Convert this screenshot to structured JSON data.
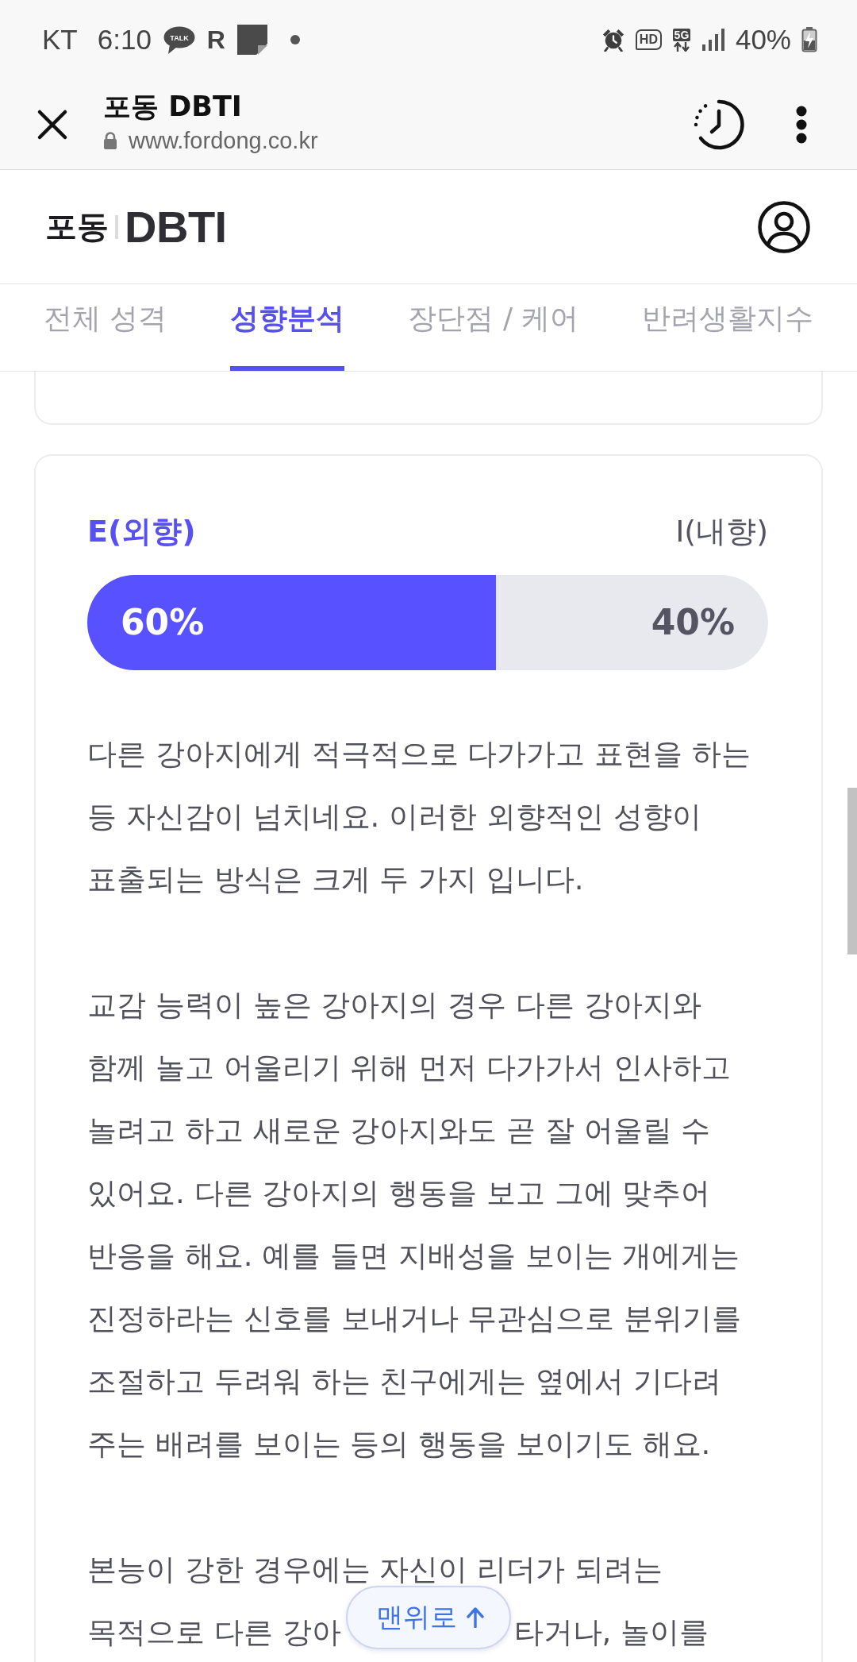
{
  "status_bar": {
    "carrier": "KT",
    "time": "6:10",
    "notifications": [
      {
        "kind": "bubble",
        "label": "TALK"
      },
      {
        "kind": "letter",
        "label": "R"
      },
      {
        "kind": "note"
      },
      {
        "kind": "dot"
      }
    ],
    "indicators": [
      {
        "kind": "alarm"
      },
      {
        "kind": "badge",
        "label": "HD"
      },
      {
        "kind": "network",
        "label": "5G"
      },
      {
        "kind": "signal"
      }
    ],
    "battery": "40%"
  },
  "browser_bar": {
    "title": "포동 DBTI",
    "url": "www.fordong.co.kr"
  },
  "site_header": {
    "logo": {
      "brand": "포동",
      "product": "DBTI"
    }
  },
  "tabs": [
    {
      "label": "전체 성격",
      "selected": false
    },
    {
      "label": "성향분석",
      "selected": true
    },
    {
      "label": "장단점 / 케어",
      "selected": false
    },
    {
      "label": "반려생활지수",
      "selected": false
    }
  ],
  "trait_card": {
    "left_label": "E(외향)",
    "right_label": "I(내향)",
    "level": 0.6,
    "left_reading": "60%",
    "right_reading": "40%",
    "paragraphs": [
      {
        "text": "다른 강아지에게 적극적으로 다가가고 표현을 하는 등 자신감이 넘치네요. 이러한 외향적인 성향이 표출되는 방식은 크게 두 가지 입니다."
      },
      {
        "text": "교감 능력이 높은 강아지의 경우 다른 강아지와 함께 놀고 어울리기 위해 먼저 다가가서 인사하고 놀려고 하고 새로운 강아지와도 곧 잘 어울릴 수 있어요. 다른 강아지의 행동을 보고 그에 맞추어 반응을 해요. 예를 들면 지배성을 보이는 개에게는 진정하라는 신호를 보내거나 무관심으로 분위기를 조절하고 두려워 하는 친구에게는 옆에서 기다려 주는 배려를 보이는 등의 행동을 보이기도 해요."
      },
      {
        "lines": [
          [
            "본능이 강한 경우에는 자신이 리더가 되려는"
          ],
          [
            "목적으로 다른 강아",
            "타거나, 놀이를"
          ]
        ]
      }
    ]
  },
  "back_to_top": {
    "label": "맨위로"
  }
}
